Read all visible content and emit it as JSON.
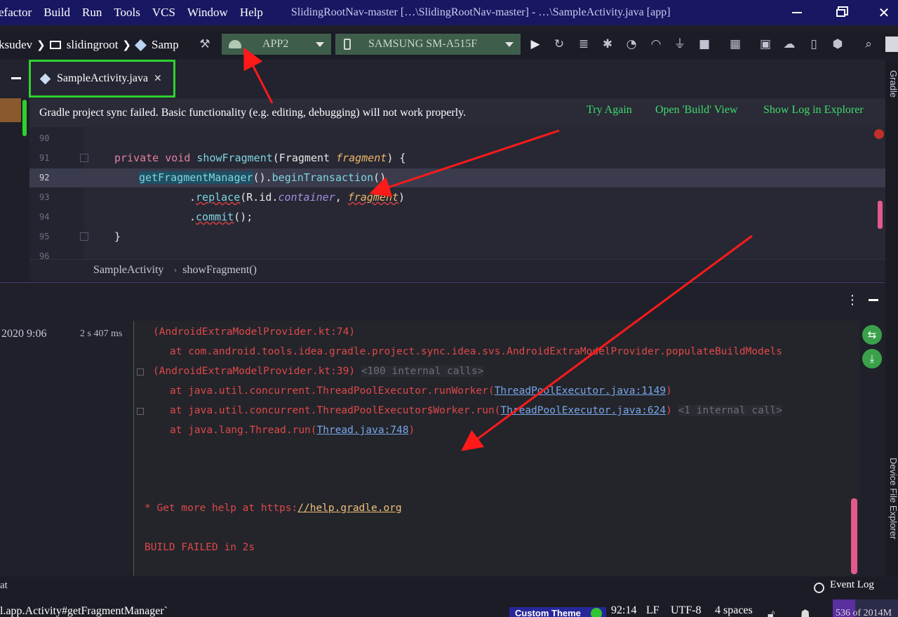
{
  "menubar": {
    "items": [
      "efactor",
      "Build",
      "Run",
      "Tools",
      "VCS",
      "Window",
      "Help"
    ],
    "title": "SlidingRootNav-master […\\SlidingRootNav-master] - …\\SampleActivity.java [app]"
  },
  "navbar": {
    "crumbs": [
      "ksudev",
      "slidingroot",
      "Samp"
    ],
    "run_config": "APP2",
    "device": "SAMSUNG SM-A515F"
  },
  "editor": {
    "tab_label": "SampleActivity.java",
    "banner": {
      "message": "Gradle project sync failed. Basic functionality (e.g. editing, debugging) will not work properly.",
      "actions": [
        "Try Again",
        "Open 'Build' View",
        "Show Log in Explorer"
      ]
    },
    "line_numbers": [
      "90",
      "91",
      "92",
      "93",
      "94",
      "95",
      "96"
    ],
    "code": {
      "l91_kw": "private void ",
      "l91_fn": "showFragment",
      "l91_a": "(Fragment ",
      "l91_param": "fragment",
      "l91_b": ") {",
      "l92_fn": "getFragmentManager",
      "l92_a": "().",
      "l92_fn2": "beginTransaction",
      "l92_b": "()",
      "l93_a": ".",
      "l93_fn": "replace",
      "l93_b": "(R.id.",
      "l93_fld": "container",
      "l93_c": ", ",
      "l93_param": "fragment",
      "l93_d": ")",
      "l94_a": ".",
      "l94_fn": "commit",
      "l94_b": "();",
      "l95": "}"
    },
    "breadcrumbs": [
      "SampleActivity",
      "showFragment()"
    ]
  },
  "build": {
    "timestamp": "2020 9:06",
    "duration": "2 s 407 ms",
    "lines": {
      "l1": "(AndroidExtraModelProvider.kt:74)",
      "l2": "at com.android.tools.idea.gradle.project.sync.idea.svs.AndroidExtraModelProvider.populateBuildModels",
      "l3": "(AndroidExtraModelProvider.kt:39)",
      "l3_dim": "<100 internal calls>",
      "l4_a": "at java.util.concurrent.ThreadPoolExecutor.runWorker(",
      "l4_link": "ThreadPoolExecutor.java:1149",
      "l4_b": ")",
      "l5_a": "at java.util.concurrent.ThreadPoolExecutor$Worker.run(",
      "l5_link": "ThreadPoolExecutor.java:624",
      "l5_b": ")",
      "l5_dim": "<1 internal call>",
      "l6_a": "at java.lang.Thread.run(",
      "l6_link": "Thread.java:748",
      "l6_b": ")",
      "help_a": "* Get more help at https:",
      "help_link": "//help.gradle.org",
      "failed": "BUILD FAILED in 2s"
    }
  },
  "right_stripe": {
    "top_label": "Gradle",
    "bottom_label": "Device File Explorer"
  },
  "statusbar": {
    "left_top": "at",
    "left_bottom": "l.app.Activity#getFragmentManager`",
    "event_log": "Event Log",
    "theme": "Custom Theme",
    "position": "92:14",
    "line_sep": "LF",
    "encoding": "UTF-8",
    "indent": "4 spaces",
    "memory": "536 of 2014M"
  },
  "colors": {
    "menubar": "#171762",
    "accent_green": "#2fd12f",
    "error_red": "#e04848",
    "annotation_arrow": "#ff1a1a"
  }
}
